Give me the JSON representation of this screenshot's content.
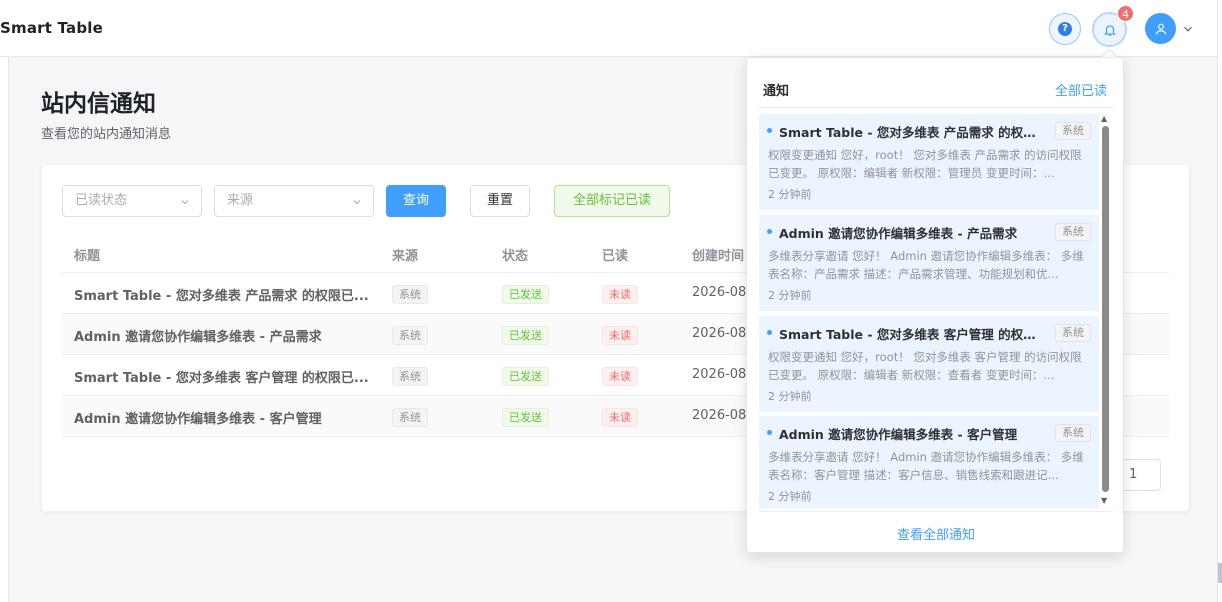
{
  "header": {
    "app_title": "Smart Table",
    "notification_count": "4"
  },
  "page": {
    "title": "站内信通知",
    "subtitle": "查看您的站内通知消息"
  },
  "filters": {
    "read_status_placeholder": "已读状态",
    "source_placeholder": "来源",
    "query_label": "查询",
    "reset_label": "重置",
    "mark_all_label": "全部标记已读"
  },
  "table": {
    "columns": [
      "标题",
      "来源",
      "状态",
      "已读",
      "创建时间"
    ],
    "rows": [
      {
        "title": "Smart Table - 您对多维表 产品需求 的权限已...",
        "source": "系统",
        "status": "已发送",
        "read": "未读",
        "time": "2026-08-"
      },
      {
        "title": "Admin 邀请您协作编辑多维表 - 产品需求",
        "source": "系统",
        "status": "已发送",
        "read": "未读",
        "time": "2026-08-"
      },
      {
        "title": "Smart Table - 您对多维表 客户管理 的权限已...",
        "source": "系统",
        "status": "已发送",
        "read": "未读",
        "time": "2026-08-"
      },
      {
        "title": "Admin 邀请您协作编辑多维表 - 客户管理",
        "source": "系统",
        "status": "已发送",
        "read": "未读",
        "time": "2026-08-"
      }
    ]
  },
  "pagination": {
    "current_page": "1"
  },
  "notifications_popover": {
    "title": "通知",
    "mark_all_read": "全部已读",
    "view_all": "查看全部通知",
    "items": [
      {
        "title": "Smart Table - 您对多维表 产品需求 的权限...",
        "tag": "系统",
        "body": "权限变更通知 您好，root！ 您对多维表 产品需求 的访问权限已变更。 原权限：编辑者 新权限：管理员 变更时间：...",
        "time": "2 分钟前"
      },
      {
        "title": "Admin 邀请您协作编辑多维表 - 产品需求",
        "tag": "系统",
        "body": "多维表分享邀请 您好！ Admin 邀请您协作编辑多维表： 多维表名称：产品需求 描述：产品需求管理、功能规划和优...",
        "time": "2 分钟前"
      },
      {
        "title": "Smart Table - 您对多维表 客户管理 的权限...",
        "tag": "系统",
        "body": "权限变更通知 您好，root！ 您对多维表 客户管理 的访问权限已变更。 原权限：编辑者 新权限：查看者 变更时间：...",
        "time": "2 分钟前"
      },
      {
        "title": "Admin 邀请您协作编辑多维表 - 客户管理",
        "tag": "系统",
        "body": "多维表分享邀请 您好！ Admin 邀请您协作编辑多维表： 多维表名称：客户管理 描述：客户信息、销售线索和跟进记...",
        "time": "2 分钟前"
      }
    ]
  },
  "colors": {
    "primary": "#409eff",
    "success": "#67c23a",
    "danger": "#f56c6c",
    "unread_bg": "#ecf5ff"
  }
}
